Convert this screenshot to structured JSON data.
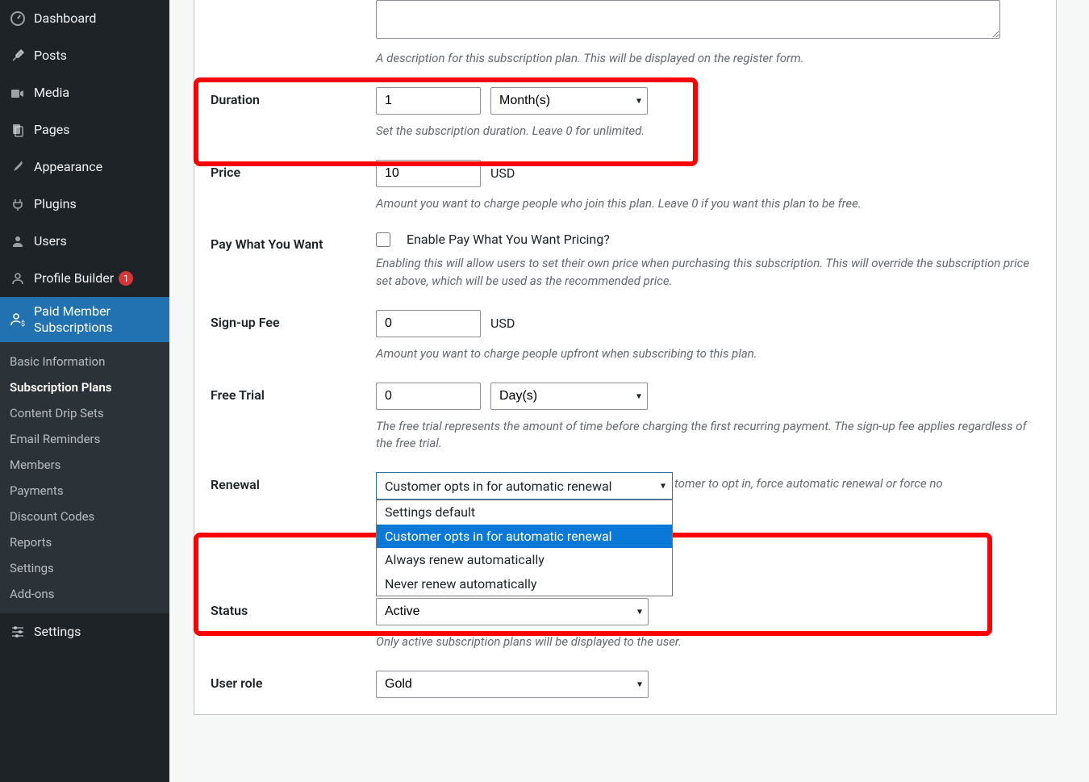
{
  "sidebar": {
    "items": [
      {
        "label": "Dashboard",
        "icon": "dashboard-icon"
      },
      {
        "label": "Posts",
        "icon": "pin-icon"
      },
      {
        "label": "Media",
        "icon": "media-icon"
      },
      {
        "label": "Pages",
        "icon": "pages-icon"
      },
      {
        "label": "Appearance",
        "icon": "brush-icon"
      },
      {
        "label": "Plugins",
        "icon": "plug-icon"
      },
      {
        "label": "Users",
        "icon": "user-icon"
      },
      {
        "label": "Profile Builder",
        "icon": "person-icon",
        "badge": "1"
      },
      {
        "label": "Paid Member Subscriptions",
        "icon": "person-dollar-icon",
        "current": true
      },
      {
        "label": "Settings",
        "icon": "sliders-icon"
      }
    ],
    "sub_items": [
      "Basic Information",
      "Subscription Plans",
      "Content Drip Sets",
      "Email Reminders",
      "Members",
      "Payments",
      "Discount Codes",
      "Reports",
      "Settings",
      "Add-ons"
    ],
    "sub_active": "Subscription Plans"
  },
  "form": {
    "description_help": "A description for this subscription plan. This will be displayed on the register form.",
    "duration": {
      "label": "Duration",
      "value": "1",
      "unit": "Month(s)",
      "help": "Set the subscription duration. Leave 0 for unlimited."
    },
    "price": {
      "label": "Price",
      "value": "10",
      "currency": "USD",
      "help": "Amount you want to charge people who join this plan. Leave 0 if you want this plan to be free."
    },
    "pwyw": {
      "label": "Pay What You Want",
      "checkbox_label": "Enable Pay What You Want Pricing?",
      "help": "Enabling this will allow users to set their own price when purchasing this subscription. This will override the subscription price set above, which will be used as the recommended price."
    },
    "signup_fee": {
      "label": "Sign-up Fee",
      "value": "0",
      "currency": "USD",
      "help": "Amount you want to charge people upfront when subscribing to this plan."
    },
    "free_trial": {
      "label": "Free Trial",
      "value": "0",
      "unit": "Day(s)",
      "help": "The free trial represents the amount of time before charging the first recurring payment. The sign-up fee applies regardless of the free trial."
    },
    "renewal": {
      "label": "Renewal",
      "selected": "Customer opts in for automatic renewal",
      "options": [
        "Settings default",
        "Customer opts in for automatic renewal",
        "Always renew automatically",
        "Never renew automatically"
      ],
      "help_partial": "tomer to opt in, force automatic renewal or force no"
    },
    "status": {
      "label": "Status",
      "value": "Active",
      "help": "Only active subscription plans will be displayed to the user."
    },
    "user_role": {
      "label": "User role",
      "value": "Gold"
    }
  }
}
